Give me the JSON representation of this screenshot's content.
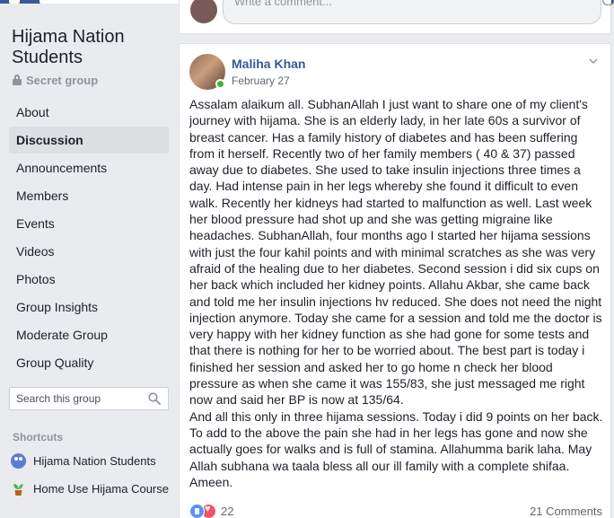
{
  "group": {
    "name": "Hijama Nation Students",
    "privacy": "Secret group"
  },
  "nav": {
    "items": [
      {
        "label": "About"
      },
      {
        "label": "Discussion",
        "active": true
      },
      {
        "label": "Announcements"
      },
      {
        "label": "Members"
      },
      {
        "label": "Events"
      },
      {
        "label": "Videos"
      },
      {
        "label": "Photos"
      },
      {
        "label": "Group Insights"
      },
      {
        "label": "Moderate Group"
      },
      {
        "label": "Group Quality"
      }
    ]
  },
  "search": {
    "placeholder": "Search this group",
    "icon": "search-icon"
  },
  "shortcuts": {
    "title": "Shortcuts",
    "items": [
      {
        "label": "Hijama Nation Students",
        "icon": "group-icon"
      },
      {
        "label": "Home Use Hijama Course",
        "icon": "plant-icon"
      }
    ]
  },
  "previous_post": {
    "comment_placeholder": "Write a comment..."
  },
  "post": {
    "author": "Maliha Khan",
    "date": "February 27",
    "body": "Assalam alaikum all. SubhanAllah I just want to share one of my client's journey with hijama. She is an elderly lady, in her late 60s a survivor of breast cancer. Has a family history of diabetes and has been suffering from it herself. Recently two of her family members ( 40 & 37) passed away due to diabetes. She used to take insulin injections three times a day. Had intense pain in her legs whereby she found it difficult to even walk. Recently her kidneys had started to malfunction as well. Last week her blood pressure had shot up and she was getting migraine like headaches. SubhanAllah, four months ago I started her hijama sessions with just the four kahil points and with minimal scratches as she was very afraid of the healing due to her diabetes. Second session i did six cups on her back which included her kidney points. Allahu Akbar, she came back and told me her insulin injections hv reduced. She does not need the night injection anymore. Today she came for a session and told me the doctor is very happy with her kidney function as she had gone for some tests and that there is nothing for her to be worried about. The best part is today i finished her session and asked her to go home n check her blood pressure as when she came it was 155/83, she just messaged me right now and said her BP is now at 135/64.\nAnd all this only in three hijama sessions. Today i did 9 points on her back. To add to the above the pain she had in her legs has gone and now she actually goes for walks and is full of stamina. Allahumma barik laha. May Allah subhana wa taala bless all our ill family with a complete shifaa. Ameen.",
    "reaction_count": "22",
    "comment_count": "21 Comments",
    "colors": {
      "author_link": "#365899",
      "online": "#42b72a",
      "like": "#5890ff",
      "love": "#f25268"
    }
  }
}
